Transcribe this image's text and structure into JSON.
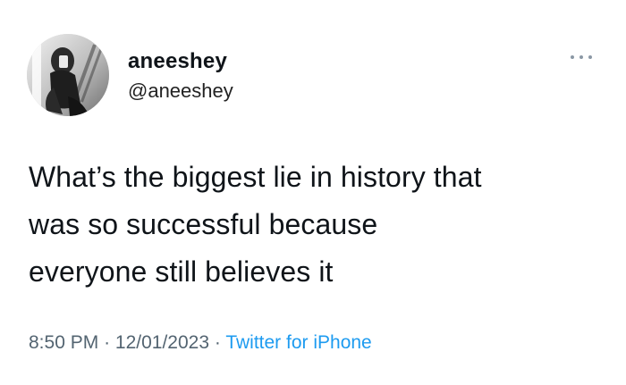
{
  "tweet": {
    "display_name": "aneeshey",
    "handle": "@aneeshey",
    "avatar_icon": "profile-photo-avatar",
    "text_lines": [
      "What’s the biggest lie in history that",
      "was so successful because",
      "everyone still believes it"
    ],
    "time": "8:50 PM",
    "separator": "·",
    "date": "12/01/2023",
    "source": "Twitter for iPhone",
    "more_icon": "more-options-icon"
  },
  "colors": {
    "text": "#0f1419",
    "meta": "#536471",
    "link": "#1d9bf0",
    "more_dots": "#8b98a5"
  }
}
